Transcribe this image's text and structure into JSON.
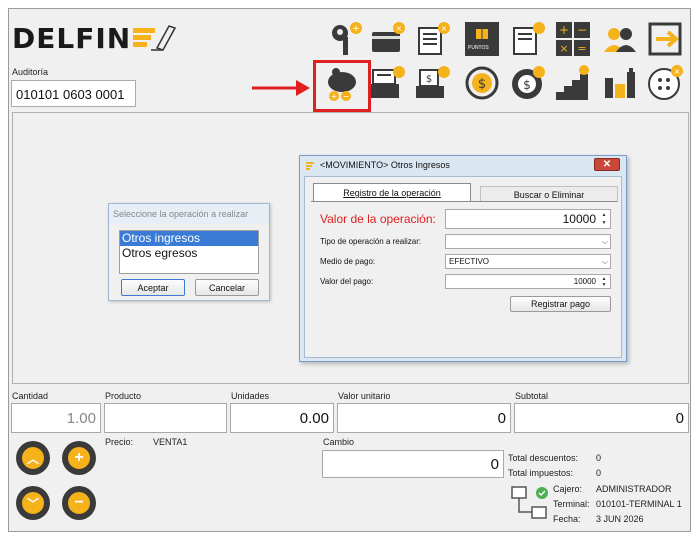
{
  "app": {
    "logo": "DELFIN"
  },
  "audit": {
    "label": "Auditoría",
    "value": "010101 0603 0001"
  },
  "toolbar": {
    "row1": [
      "key-add-icon",
      "card-payment-icon",
      "document-list-add-icon",
      "points-icon",
      "document-search-icon",
      "calculator-icon",
      "users-icon",
      "exit-icon"
    ],
    "row2": [
      "piggy-bank-movement-icon",
      "printer-add-icon",
      "cash-register-add-icon",
      "currency-refresh-icon",
      "currency-settings-icon",
      "stairs-chart-icon",
      "bottles-icon",
      "buttons-icon"
    ],
    "points_label": "PUNTOS"
  },
  "op_select": {
    "title": "Seleccione la operación a realizar",
    "options": [
      "Otros ingresos",
      "Otros egresos"
    ],
    "selected_index": 0,
    "accept": "Aceptar",
    "cancel": "Cancelar"
  },
  "movement_dialog": {
    "title": "<MOVIMIENTO> Otros Ingresos",
    "close": "✕",
    "tabs": [
      "Registro de la operación",
      "Buscar o Eliminar"
    ],
    "fields": {
      "valor_label": "Valor de la operación:",
      "valor_value": "10000",
      "tipo_label": "Tipo de operación a realizar:",
      "tipo_value": "",
      "medio_label": "Medio de pago:",
      "medio_value": "EFECTIVO",
      "pago_label": "Valor del pago:",
      "pago_value": "10000"
    },
    "register_button": "Registrar pago"
  },
  "sale": {
    "cantidad_label": "Cantidad",
    "cantidad_value": "1.00",
    "producto_label": "Producto",
    "producto_value": "",
    "unidades_label": "Unidades",
    "unidades_value": "0.00",
    "valor_unitario_label": "Valor unitario",
    "valor_unitario_value": "0",
    "subtotal_label": "Subtotal",
    "subtotal_value": "0",
    "precio_label": "Precio:",
    "precio_value": "VENTA1",
    "cambio_label": "Cambio",
    "cambio_value": "0"
  },
  "totals": {
    "descuentos_label": "Total descuentos:",
    "descuentos_value": "0",
    "impuestos_label": "Total impuestos:",
    "impuestos_value": "0"
  },
  "session": {
    "cajero_label": "Cajero:",
    "cajero_value": "ADMINISTRADOR",
    "terminal_label": "Terminal:",
    "terminal_value": "010101-TERMINAL 1",
    "fecha_label": "Fecha:",
    "fecha_value": "3 JUN 2026"
  },
  "colors": {
    "accent_orange": "#f5b21a",
    "icon_dark": "#3a3a3a",
    "highlight_red": "#e02020",
    "required_label": "#e02020"
  }
}
